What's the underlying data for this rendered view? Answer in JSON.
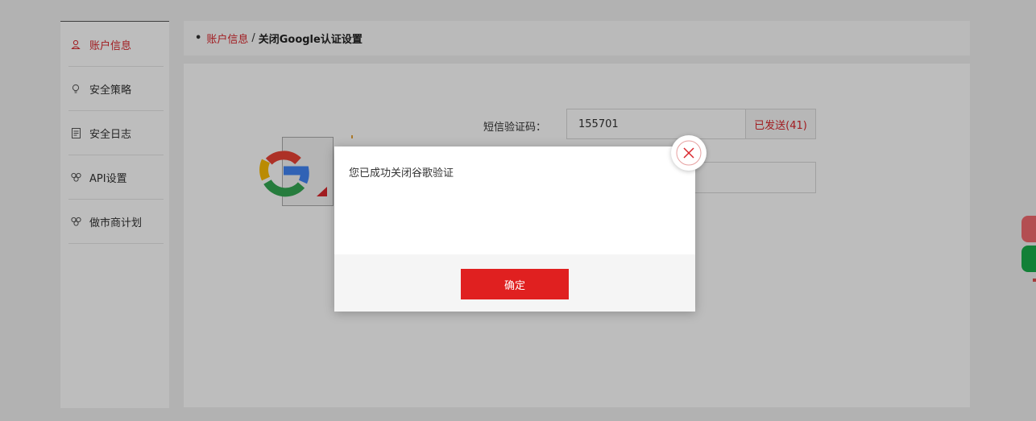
{
  "sidebar": {
    "items": [
      {
        "label": "账户信息",
        "icon": "user-icon",
        "active": true
      },
      {
        "label": "安全策略",
        "icon": "bulb-icon",
        "active": false
      },
      {
        "label": "安全日志",
        "icon": "document-icon",
        "active": false
      },
      {
        "label": "API设置",
        "icon": "api-icon",
        "active": false
      },
      {
        "label": "做市商计划",
        "icon": "market-maker-icon",
        "active": false
      }
    ]
  },
  "breadcrumb": {
    "dot": "•",
    "parent": "账户信息",
    "separator": "/",
    "current": "关闭Google认证设置"
  },
  "form": {
    "sms_label": "短信验证码：",
    "sms_value": "155701",
    "sms_sent": "已发送(41)",
    "code_value": ""
  },
  "modal": {
    "message": "您已成功关闭谷歌验证",
    "confirm": "确定"
  },
  "colors": {
    "accent": "#d9262c",
    "button": "#e02020",
    "green": "#1aad4b"
  }
}
